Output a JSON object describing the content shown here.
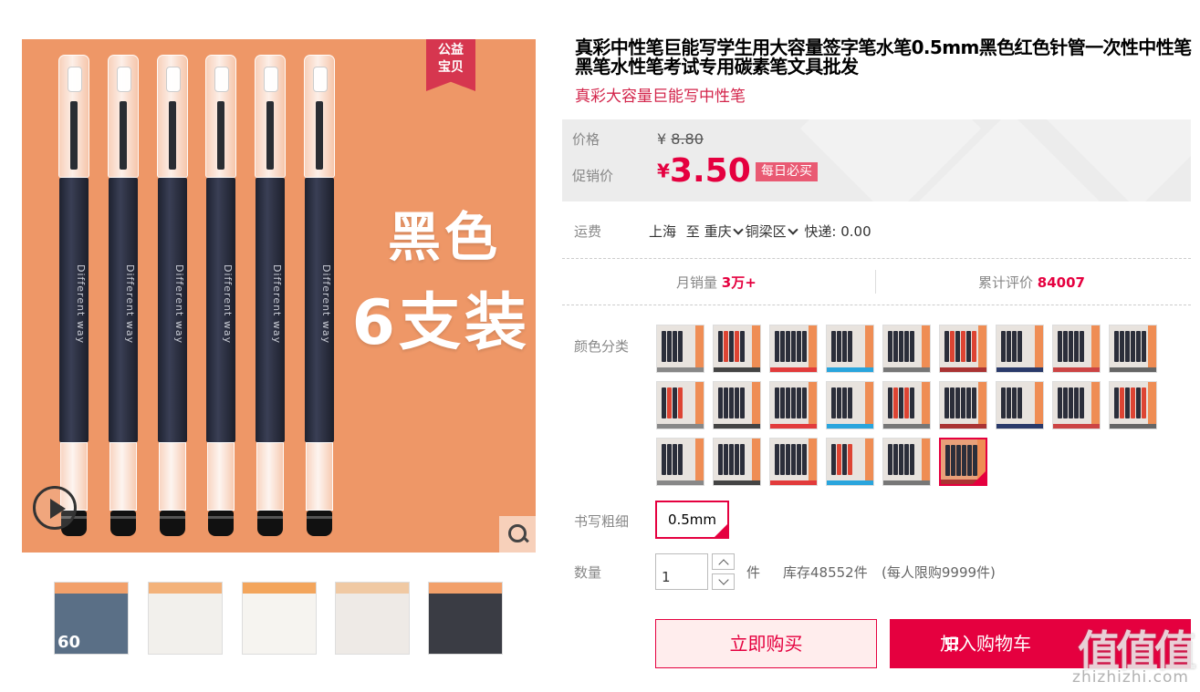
{
  "gallery": {
    "badge": [
      "公益",
      "宝贝"
    ],
    "hero_line1": "黑色",
    "hero_line2": "6支装",
    "pen_label": "Different way",
    "thumb_badge_number": "60"
  },
  "product": {
    "title": "真彩中性笔巨能写学生用大容量签字笔水笔0.5mm黑色红色针管一次性中性笔黑笔水性笔考试专用碳素笔文具批发",
    "subtitle": "真彩大容量巨能写中性笔"
  },
  "price": {
    "label": "价格",
    "currency": "¥",
    "original": "8.80",
    "promo_label": "促销价",
    "promo": "3.50",
    "promo_tag": "每日必买"
  },
  "shipping": {
    "label": "运费",
    "from": "上海",
    "to_word": "至",
    "city": "重庆",
    "district": "铜梁区",
    "method": "快递: 0.00"
  },
  "stats": {
    "monthly_sales_label": "月销量",
    "monthly_sales": "3万+",
    "reviews_label": "累计评价",
    "reviews": "84007"
  },
  "options": {
    "color_label": "颜色分类",
    "color_count": 24,
    "selected_color_index": 23,
    "width_label": "书写粗细",
    "width_value": "0.5mm"
  },
  "quantity": {
    "label": "数量",
    "value": "1",
    "unit": "件",
    "stock": "库存48552件",
    "limit": "(每人限购9999件)"
  },
  "actions": {
    "buy_now": "立即购买",
    "add_to_cart": "加入购物车"
  },
  "watermark": {
    "logo": "值值值",
    "url": "zhizhizhi.com"
  },
  "colors": {
    "accent": "#e5003f",
    "image_bg": "#ee9767",
    "price_box_bg": "#ececec"
  }
}
